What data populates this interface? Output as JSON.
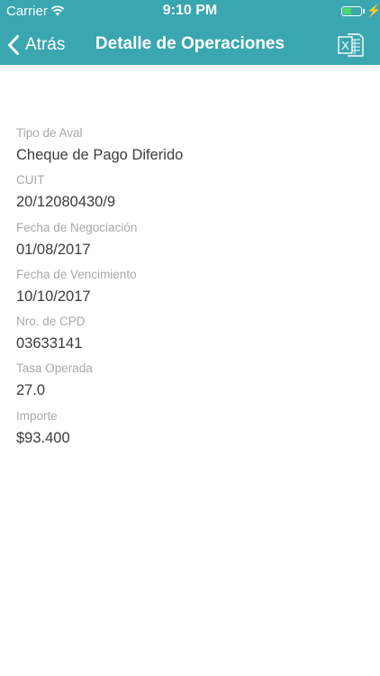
{
  "status_bar": {
    "carrier": "Carrier",
    "time": "9:10 PM",
    "battery_level": 0.45,
    "icons": [
      "wifi-icon",
      "battery-icon",
      "charging-bolt-icon"
    ]
  },
  "nav": {
    "back_label": "Atrás",
    "title": "Detalle de Operaciones",
    "action_icon": "excel-icon",
    "action_icon_letter": "X"
  },
  "fields": [
    {
      "label": "Tipo de Aval",
      "value": "Cheque de Pago Diferido"
    },
    {
      "label": "CUIT",
      "value": "20/12080430/9"
    },
    {
      "label": "Fecha de Negociación",
      "value": "01/08/2017"
    },
    {
      "label": "Fecha de Vencimiento",
      "value": "10/10/2017"
    },
    {
      "label": "Nro. de CPD",
      "value": "03633141"
    },
    {
      "label": "Tasa Operada",
      "value": "27.0"
    },
    {
      "label": "Importe",
      "value": "$93.400"
    }
  ],
  "colors": {
    "header_background": "#3aa6b0",
    "header_text": "#ffffff",
    "label_text": "#a8a8a8",
    "value_text": "#3c3c3c",
    "battery_fill": "#4cd964"
  }
}
